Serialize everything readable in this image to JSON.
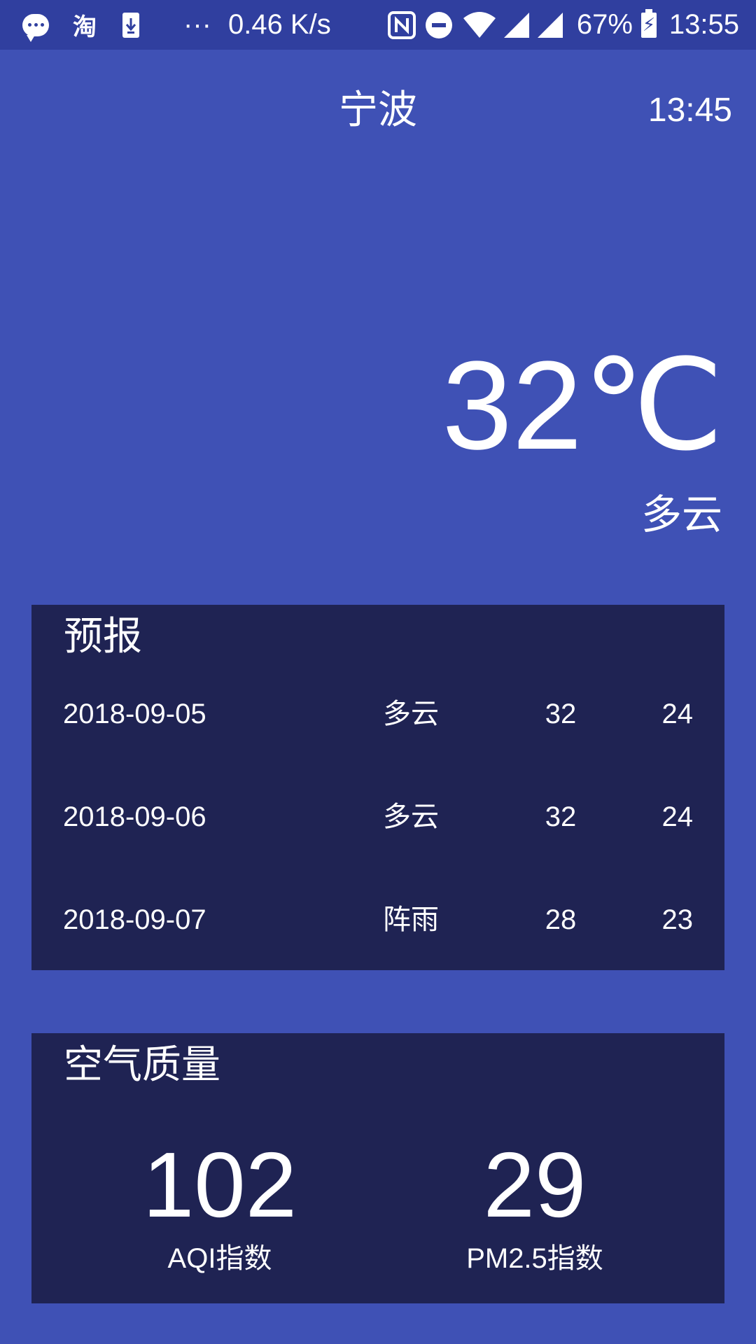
{
  "status_bar": {
    "left_icons": [
      "message-icon",
      "taobao-icon",
      "download-icon"
    ],
    "taobao_glyph": "淘",
    "more": "···",
    "net_speed": "0.46 K/s",
    "battery": "67%",
    "clock": "13:55"
  },
  "header": {
    "city": "宁波",
    "update_time": "13:45"
  },
  "now": {
    "temperature": "32℃",
    "condition": "多云"
  },
  "forecast": {
    "title": "预报",
    "rows": [
      {
        "date": "2018-09-05",
        "condition": "多云",
        "max": "32",
        "min": "24"
      },
      {
        "date": "2018-09-06",
        "condition": "多云",
        "max": "32",
        "min": "24"
      },
      {
        "date": "2018-09-07",
        "condition": "阵雨",
        "max": "28",
        "min": "23"
      }
    ]
  },
  "air_quality": {
    "title": "空气质量",
    "aqi_value": "102",
    "aqi_label": "AQI指数",
    "pm25_value": "29",
    "pm25_label": "PM2.5指数"
  },
  "colors": {
    "background": "#3F51B5",
    "status_bar": "#303F9F",
    "card": "#1F2353",
    "text": "#FFFFFF"
  }
}
